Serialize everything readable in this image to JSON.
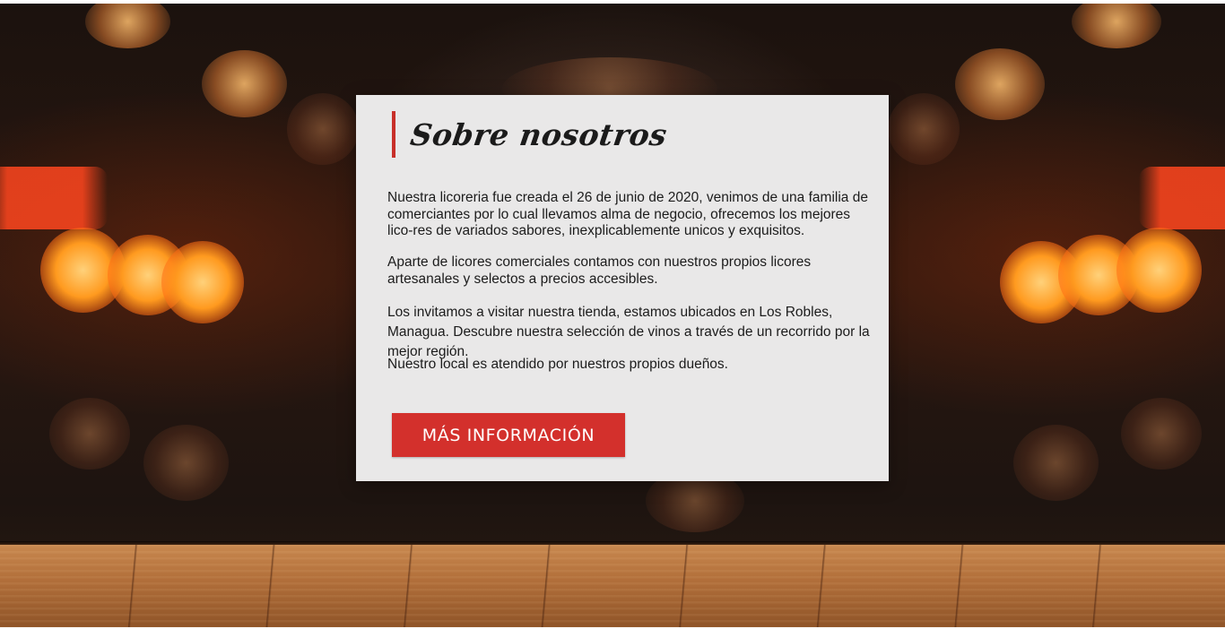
{
  "about": {
    "title": "Sobre nosotros",
    "paragraphs": [
      "Nuestra licoreria fue creada el 26 de junio de 2020, venimos de una familia  de comerciantes por lo cual llevamos alma de negocio, ofrecemos los mejores lico-res de variados sabores, inexplicablemente unicos y exquisitos.",
      "Aparte de licores comerciales contamos con nuestros propios licores artesanales y selectos a precios accesibles.",
      "Los invitamos a visitar nuestra tienda, estamos ubicados en Los Robles, Managua. Descubre nuestra selección de vinos a través de un recorrido por la mejor región.",
      "Nuestro local es atendido por nuestros propios dueños."
    ],
    "button_label": "MÁS INFORMACIÓN"
  },
  "colors": {
    "accent": "#d3302c",
    "card_background": "#e9e8e8",
    "heading_bar": "#c8302a"
  }
}
